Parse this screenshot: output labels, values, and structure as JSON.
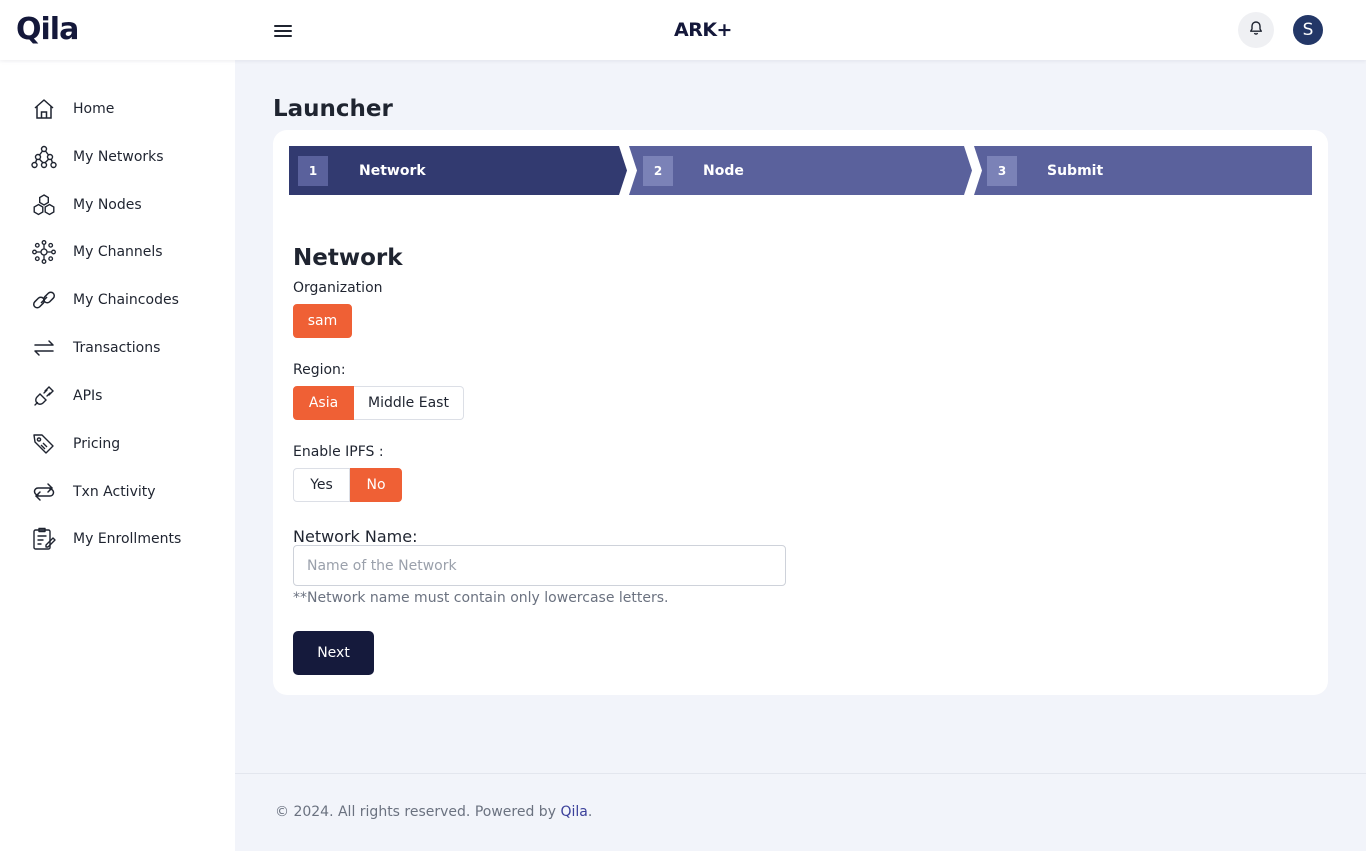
{
  "header": {
    "logo_text": "Qila",
    "brand_text": "ARK+",
    "avatar_initial": "S",
    "icons": [
      "hamburger-menu-icon",
      "bell-icon"
    ]
  },
  "sidebar": {
    "items": [
      {
        "label": "Home",
        "icon": "home-icon"
      },
      {
        "label": "My Networks",
        "icon": "network-icon"
      },
      {
        "label": "My Nodes",
        "icon": "nodes-icon"
      },
      {
        "label": "My Channels",
        "icon": "channels-icon"
      },
      {
        "label": "My Chaincodes",
        "icon": "link-icon"
      },
      {
        "label": "Transactions",
        "icon": "arrows-exchange-icon"
      },
      {
        "label": "APIs",
        "icon": "plug-icon"
      },
      {
        "label": "Pricing",
        "icon": "tags-icon"
      },
      {
        "label": "Txn Activity",
        "icon": "loop-arrows-icon"
      },
      {
        "label": "My Enrollments",
        "icon": "clipboard-edit-icon"
      }
    ]
  },
  "main": {
    "page_title": "Launcher",
    "steps": [
      {
        "num": "1",
        "label": "Network",
        "active": true
      },
      {
        "num": "2",
        "label": "Node",
        "active": false
      },
      {
        "num": "3",
        "label": "Submit",
        "active": false
      }
    ],
    "form": {
      "title": "Network",
      "organization": {
        "label": "Organization",
        "options": [
          "sam"
        ],
        "selected": "sam"
      },
      "region": {
        "label": "Region:",
        "options": [
          "Asia",
          "Middle East"
        ],
        "selected": "Asia"
      },
      "ipfs": {
        "label": "Enable IPFS :",
        "options": [
          "Yes",
          "No"
        ],
        "selected": "No"
      },
      "network_name": {
        "label": "Network Name:",
        "placeholder": "Name of the Network",
        "value": "",
        "hint": "**Network name must contain only lowercase letters."
      },
      "next_label": "Next"
    }
  },
  "footer": {
    "text_prefix": "© 2024. All rights reserved. Powered by ",
    "link_text": "Qila",
    "text_suffix": "."
  },
  "colors": {
    "accent": "#ef6035",
    "primary_dark": "#151a3c",
    "step_active": "#323a70",
    "step_inactive": "#5a619c"
  }
}
